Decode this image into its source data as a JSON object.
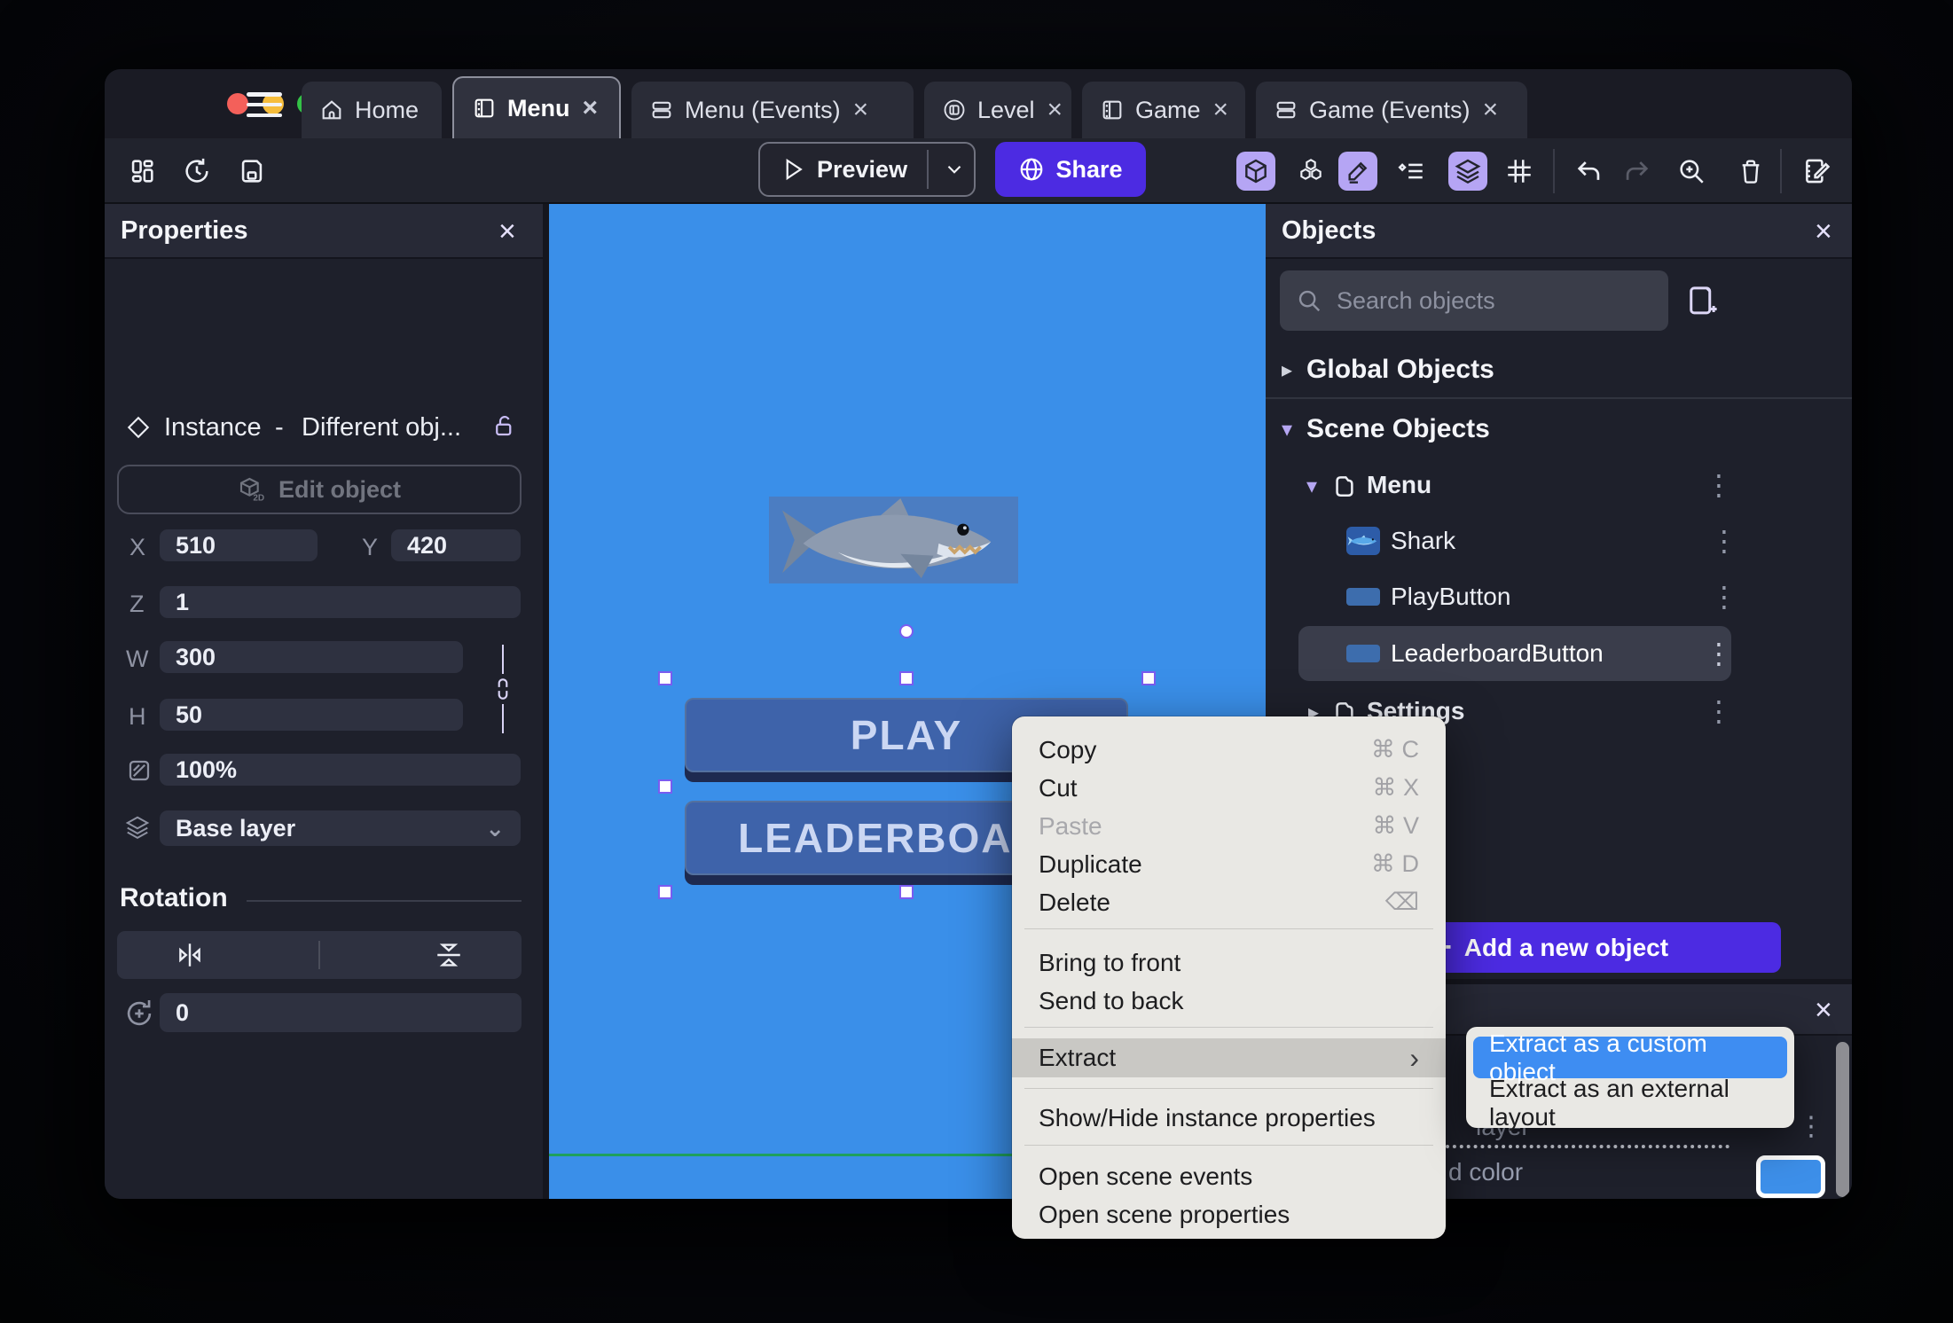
{
  "colors": {
    "accent_purple": "#4c2be2",
    "toggle_lavender": "#b5a5f4",
    "canvas_blue": "#3a8fe9",
    "game_button_blue": "#3e63aa",
    "scene_line_green": "#1fa05e",
    "menu_highlight_blue": "#3e8df2",
    "selection_handle_purple": "#7a5cf0",
    "traffic_red": "#f4605a",
    "traffic_yellow": "#f6bd3c",
    "traffic_green": "#33c246"
  },
  "window": {
    "tabs": [
      {
        "label": "Home",
        "close": ""
      },
      {
        "label": "Menu",
        "close": "×"
      },
      {
        "label": "Menu (Events)",
        "close": "×"
      },
      {
        "label": "Level",
        "close": "×"
      },
      {
        "label": "Game",
        "close": "×"
      },
      {
        "label": "Game (Events)",
        "close": "×"
      }
    ]
  },
  "toolbar": {
    "preview_label": "Preview",
    "share_label": "Share"
  },
  "properties": {
    "title": "Properties",
    "close": "×",
    "instance_label": "Instance",
    "dash": "-",
    "object_name": "Different obj...",
    "edit_object_label": "Edit object",
    "x_label": "X",
    "x_value": "510",
    "y_label": "Y",
    "y_value": "420",
    "z_label": "Z",
    "z_value": "1",
    "w_label": "W",
    "w_value": "300",
    "h_label": "H",
    "h_value": "50",
    "opacity_value": "100%",
    "layer_value": "Base layer",
    "layer_chevron": "⌄",
    "rotation_title": "Rotation",
    "rotation_value": "0"
  },
  "canvas": {
    "play_label": "PLAY",
    "leaderboard_label": "LEADERBOARD"
  },
  "objects_panel": {
    "title": "Objects",
    "close": "×",
    "search_placeholder": "Search objects",
    "global_group": "Global Objects",
    "global_arrow": "▸",
    "scene_group": "Scene Objects",
    "scene_arrow": "▾",
    "kebab": "⋮",
    "tree": [
      {
        "label": "Menu",
        "arrow": "▾"
      },
      {
        "label": "Shark"
      },
      {
        "label": "PlayButton"
      },
      {
        "label": "LeaderboardButton"
      },
      {
        "label": "Settings",
        "arrow": "▸"
      }
    ],
    "add_button_plus": "+",
    "add_button_label": "Add a new object"
  },
  "layers_panel": {
    "close": "×",
    "layer_row_fragment": "layer",
    "kebab": "⋮",
    "color_row_fragment": "d color",
    "swatch_color": "#3d8fe9"
  },
  "context_menu": {
    "items": [
      {
        "label": "Copy",
        "shortcut": "⌘ C"
      },
      {
        "label": "Cut",
        "shortcut": "⌘ X"
      },
      {
        "label": "Paste",
        "shortcut": "⌘ V"
      },
      {
        "label": "Duplicate",
        "shortcut": "⌘ D"
      },
      {
        "label": "Delete",
        "shortcut": "⌫"
      },
      {
        "label": "Bring to front",
        "shortcut": ""
      },
      {
        "label": "Send to back",
        "shortcut": ""
      },
      {
        "label": "Extract",
        "arrow": "›"
      },
      {
        "label": "Show/Hide instance properties",
        "shortcut": ""
      },
      {
        "label": "Open scene events",
        "shortcut": ""
      },
      {
        "label": "Open scene properties",
        "shortcut": ""
      }
    ],
    "submenu": [
      {
        "label": "Extract as a custom object"
      },
      {
        "label": "Extract as an external layout"
      }
    ]
  }
}
